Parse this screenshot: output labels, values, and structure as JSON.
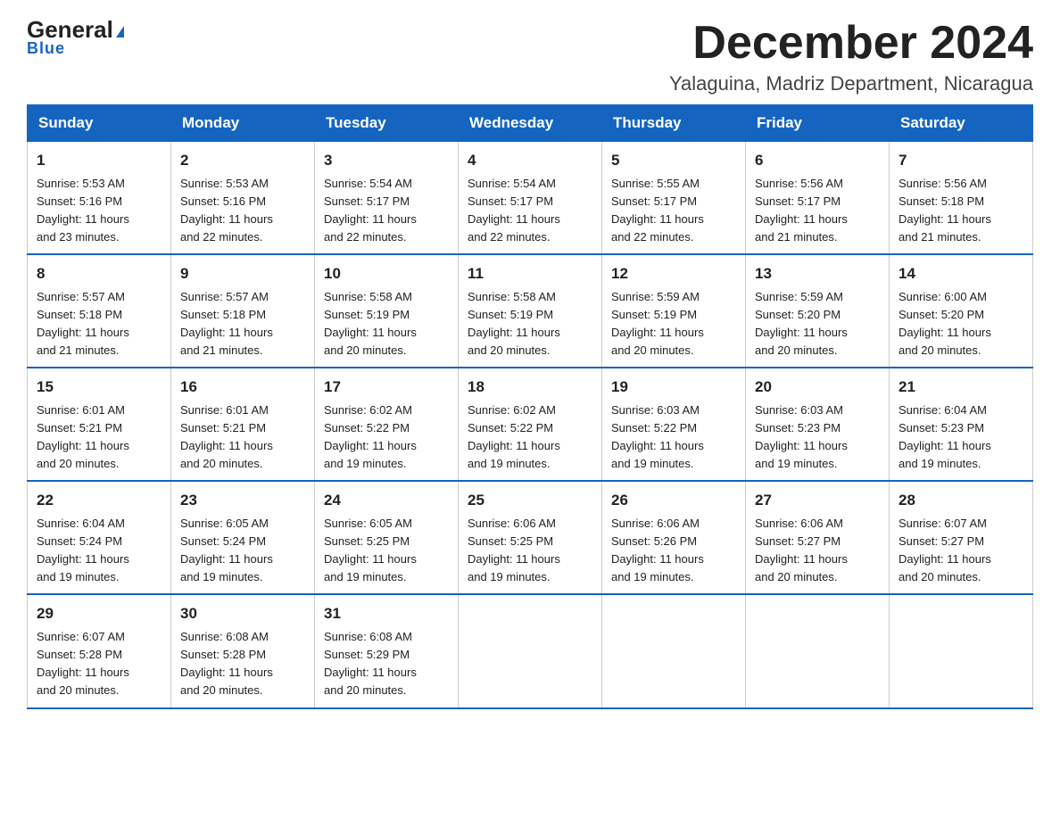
{
  "logo": {
    "general": "General",
    "blue": "Blue",
    "arrow_symbol": "▶"
  },
  "title": {
    "month_year": "December 2024",
    "location": "Yalaguina, Madriz Department, Nicaragua"
  },
  "weekdays": [
    "Sunday",
    "Monday",
    "Tuesday",
    "Wednesday",
    "Thursday",
    "Friday",
    "Saturday"
  ],
  "weeks": [
    [
      {
        "day": "1",
        "sunrise": "5:53 AM",
        "sunset": "5:16 PM",
        "daylight": "11 hours and 23 minutes."
      },
      {
        "day": "2",
        "sunrise": "5:53 AM",
        "sunset": "5:16 PM",
        "daylight": "11 hours and 22 minutes."
      },
      {
        "day": "3",
        "sunrise": "5:54 AM",
        "sunset": "5:17 PM",
        "daylight": "11 hours and 22 minutes."
      },
      {
        "day": "4",
        "sunrise": "5:54 AM",
        "sunset": "5:17 PM",
        "daylight": "11 hours and 22 minutes."
      },
      {
        "day": "5",
        "sunrise": "5:55 AM",
        "sunset": "5:17 PM",
        "daylight": "11 hours and 22 minutes."
      },
      {
        "day": "6",
        "sunrise": "5:56 AM",
        "sunset": "5:17 PM",
        "daylight": "11 hours and 21 minutes."
      },
      {
        "day": "7",
        "sunrise": "5:56 AM",
        "sunset": "5:18 PM",
        "daylight": "11 hours and 21 minutes."
      }
    ],
    [
      {
        "day": "8",
        "sunrise": "5:57 AM",
        "sunset": "5:18 PM",
        "daylight": "11 hours and 21 minutes."
      },
      {
        "day": "9",
        "sunrise": "5:57 AM",
        "sunset": "5:18 PM",
        "daylight": "11 hours and 21 minutes."
      },
      {
        "day": "10",
        "sunrise": "5:58 AM",
        "sunset": "5:19 PM",
        "daylight": "11 hours and 20 minutes."
      },
      {
        "day": "11",
        "sunrise": "5:58 AM",
        "sunset": "5:19 PM",
        "daylight": "11 hours and 20 minutes."
      },
      {
        "day": "12",
        "sunrise": "5:59 AM",
        "sunset": "5:19 PM",
        "daylight": "11 hours and 20 minutes."
      },
      {
        "day": "13",
        "sunrise": "5:59 AM",
        "sunset": "5:20 PM",
        "daylight": "11 hours and 20 minutes."
      },
      {
        "day": "14",
        "sunrise": "6:00 AM",
        "sunset": "5:20 PM",
        "daylight": "11 hours and 20 minutes."
      }
    ],
    [
      {
        "day": "15",
        "sunrise": "6:01 AM",
        "sunset": "5:21 PM",
        "daylight": "11 hours and 20 minutes."
      },
      {
        "day": "16",
        "sunrise": "6:01 AM",
        "sunset": "5:21 PM",
        "daylight": "11 hours and 20 minutes."
      },
      {
        "day": "17",
        "sunrise": "6:02 AM",
        "sunset": "5:22 PM",
        "daylight": "11 hours and 19 minutes."
      },
      {
        "day": "18",
        "sunrise": "6:02 AM",
        "sunset": "5:22 PM",
        "daylight": "11 hours and 19 minutes."
      },
      {
        "day": "19",
        "sunrise": "6:03 AM",
        "sunset": "5:22 PM",
        "daylight": "11 hours and 19 minutes."
      },
      {
        "day": "20",
        "sunrise": "6:03 AM",
        "sunset": "5:23 PM",
        "daylight": "11 hours and 19 minutes."
      },
      {
        "day": "21",
        "sunrise": "6:04 AM",
        "sunset": "5:23 PM",
        "daylight": "11 hours and 19 minutes."
      }
    ],
    [
      {
        "day": "22",
        "sunrise": "6:04 AM",
        "sunset": "5:24 PM",
        "daylight": "11 hours and 19 minutes."
      },
      {
        "day": "23",
        "sunrise": "6:05 AM",
        "sunset": "5:24 PM",
        "daylight": "11 hours and 19 minutes."
      },
      {
        "day": "24",
        "sunrise": "6:05 AM",
        "sunset": "5:25 PM",
        "daylight": "11 hours and 19 minutes."
      },
      {
        "day": "25",
        "sunrise": "6:06 AM",
        "sunset": "5:25 PM",
        "daylight": "11 hours and 19 minutes."
      },
      {
        "day": "26",
        "sunrise": "6:06 AM",
        "sunset": "5:26 PM",
        "daylight": "11 hours and 19 minutes."
      },
      {
        "day": "27",
        "sunrise": "6:06 AM",
        "sunset": "5:27 PM",
        "daylight": "11 hours and 20 minutes."
      },
      {
        "day": "28",
        "sunrise": "6:07 AM",
        "sunset": "5:27 PM",
        "daylight": "11 hours and 20 minutes."
      }
    ],
    [
      {
        "day": "29",
        "sunrise": "6:07 AM",
        "sunset": "5:28 PM",
        "daylight": "11 hours and 20 minutes."
      },
      {
        "day": "30",
        "sunrise": "6:08 AM",
        "sunset": "5:28 PM",
        "daylight": "11 hours and 20 minutes."
      },
      {
        "day": "31",
        "sunrise": "6:08 AM",
        "sunset": "5:29 PM",
        "daylight": "11 hours and 20 minutes."
      },
      null,
      null,
      null,
      null
    ]
  ]
}
